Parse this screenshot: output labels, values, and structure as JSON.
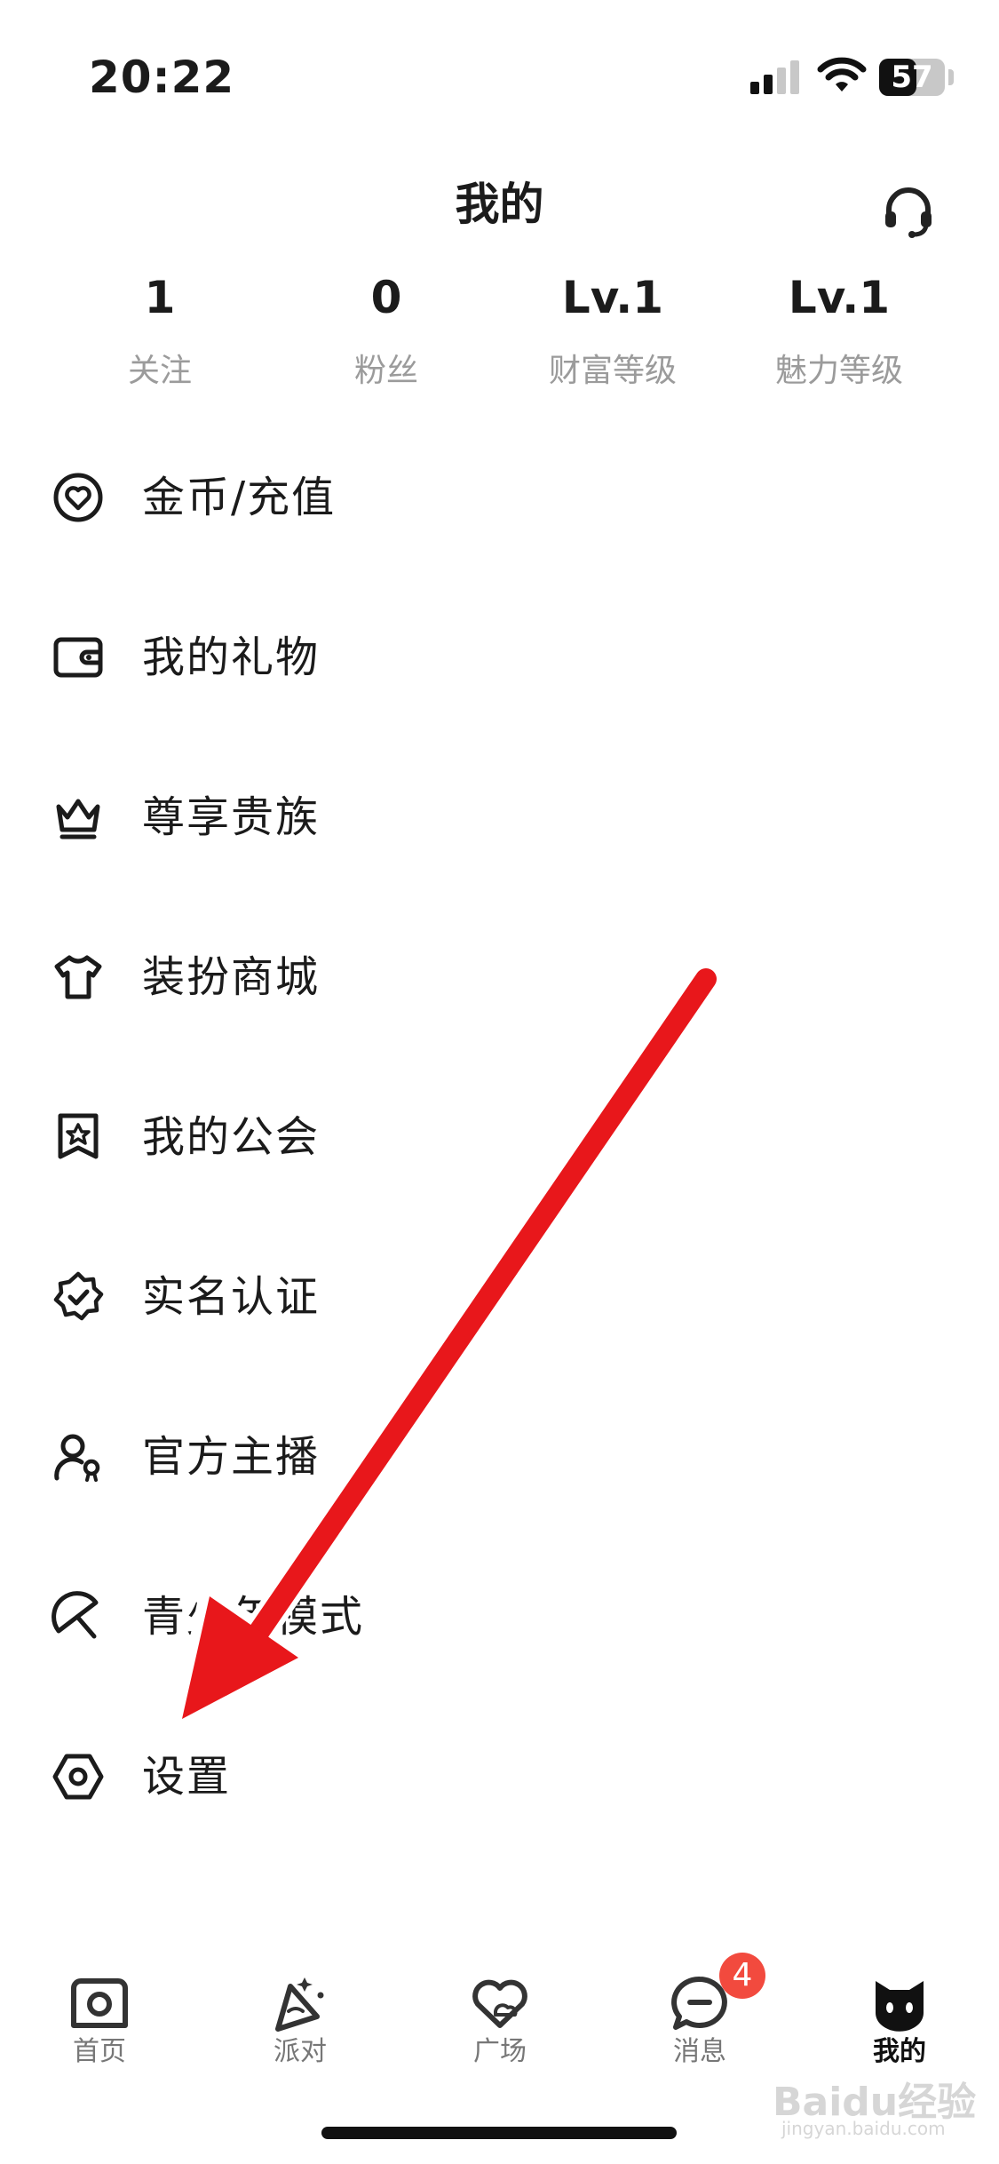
{
  "status_bar": {
    "time": "20:22",
    "battery": "57",
    "battery_level": 0.57
  },
  "header": {
    "title": "我的",
    "support_icon": "headset-icon"
  },
  "stats": [
    {
      "value": "1",
      "label": "关注"
    },
    {
      "value": "0",
      "label": "粉丝"
    },
    {
      "value": "Lv.1",
      "label": "财富等级"
    },
    {
      "value": "Lv.1",
      "label": "魅力等级"
    }
  ],
  "menu": [
    {
      "label": "金币/充值",
      "icon": "heart-coin-icon"
    },
    {
      "label": "我的礼物",
      "icon": "wallet-icon"
    },
    {
      "label": "尊享贵族",
      "icon": "crown-icon"
    },
    {
      "label": "装扮商城",
      "icon": "tshirt-icon"
    },
    {
      "label": "我的公会",
      "icon": "guild-badge-icon"
    },
    {
      "label": "实名认证",
      "icon": "verified-icon"
    },
    {
      "label": "官方主播",
      "icon": "anchor-user-icon"
    },
    {
      "label": "青少年模式",
      "icon": "umbrella-icon"
    },
    {
      "label": "设置",
      "icon": "settings-hexagon-icon"
    }
  ],
  "tabbar": {
    "tabs": [
      {
        "label": "首页",
        "icon": "camera-home-icon"
      },
      {
        "label": "派对",
        "icon": "party-icon"
      },
      {
        "label": "广场",
        "icon": "cloud-heart-icon"
      },
      {
        "label": "消息",
        "icon": "chat-bubble-icon"
      },
      {
        "label": "我的",
        "icon": "cat-face-icon"
      }
    ],
    "active_index": 4,
    "message_badge": "4"
  },
  "watermark": {
    "text": "Baidu经验",
    "sub": "jingyan.baidu.com"
  },
  "colors": {
    "arrow": "#e8171b",
    "badge": "#f24a3e",
    "muted": "#9b9b9b",
    "text": "#1b1b1b"
  }
}
